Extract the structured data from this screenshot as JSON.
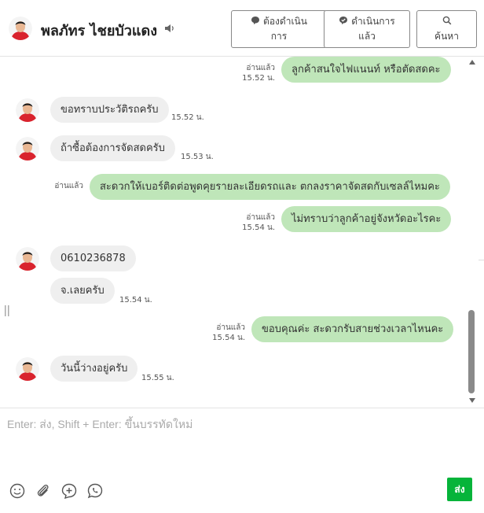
{
  "header": {
    "user_name": "พลภัทร ไชยบัวแดง",
    "btn_todo": {
      "line1": "ต้องดำเนิน",
      "line2": "การ"
    },
    "btn_done": {
      "line1": "ดำเนินการ",
      "line2": "แล้ว"
    },
    "btn_search": {
      "line1": "ค้นหา"
    }
  },
  "messages": [
    {
      "dir": "out",
      "text": "ลูกค้าสนใจไฟแนนท์ หรือตัดสดคะ",
      "read": "อ่านแล้ว",
      "time": "15.52 น."
    },
    {
      "dir": "in",
      "text": "ขอทราบประวัติรถครับ",
      "time": "15.52 น."
    },
    {
      "dir": "in",
      "text": "ถ้าซื้อต้องการจัดสดครับ",
      "time": "15.53 น."
    },
    {
      "dir": "out",
      "text": "สะดวกให้เบอร์ติดต่อพูดคุยรายละเอียดรถและ ตกลงราคาจัดสดกับเซลล์ไหมคะ",
      "read": "อ่านแล้ว",
      "time": ""
    },
    {
      "dir": "out",
      "text": "ไม่ทราบว่าลูกค้าอยู่จังหวัดอะไรคะ",
      "read": "อ่านแล้ว",
      "time": "15.54 น."
    },
    {
      "dir": "in",
      "text": "0610236878",
      "time": ""
    },
    {
      "dir": "in",
      "text": "จ.เลยครับ",
      "time": "15.54 น."
    },
    {
      "dir": "out",
      "text": "ขอบคุณค่ะ สะดวกรับสายช่วงเวลาไหนคะ",
      "read": "อ่านแล้ว",
      "time": "15.54 น."
    },
    {
      "dir": "in",
      "text": "วันนี้ว่างอยู่ครับ",
      "time": "15.55 น."
    }
  ],
  "composer": {
    "placeholder": "Enter: ส่ง, Shift + Enter: ขึ้นบรรทัดใหม่",
    "send_label": "ส่ง"
  },
  "icons": {
    "mute": "speaker-icon",
    "todo": "chat-bubble-icon",
    "done": "check-bubble-icon",
    "search": "search-icon",
    "tools": [
      "emoji-icon",
      "attachment-icon",
      "add-note-icon",
      "call-icon"
    ]
  },
  "colors": {
    "outgoing_bubble": "#bfe6b9",
    "incoming_bubble": "#efefef",
    "send_button": "#06b43a"
  }
}
